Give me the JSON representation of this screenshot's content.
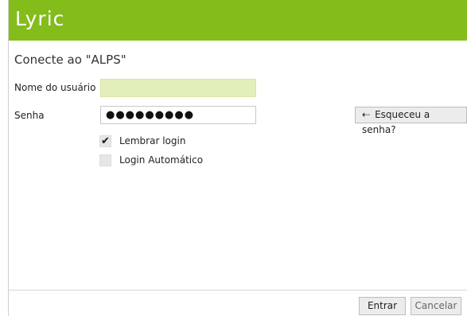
{
  "app": {
    "logo_text": "Lyric",
    "brand_color": "#84bc1c"
  },
  "login": {
    "heading": "Conecte ao  \"ALPS\"",
    "username_label": "Nome do usuário",
    "username_value": "",
    "password_label": "Senha",
    "password_value": "●●●●●●●●●",
    "forgot_icon": "login-arrow-icon",
    "forgot_glyph": "⇠",
    "forgot_label": "Esqueceu a senha?",
    "remember_label": "Lembrar login",
    "remember_checked": true,
    "remember_glyph": "✔",
    "autologin_label": "Login Automático",
    "autologin_checked": false
  },
  "footer": {
    "ok_label": "Entrar",
    "cancel_label": "Cancelar"
  }
}
